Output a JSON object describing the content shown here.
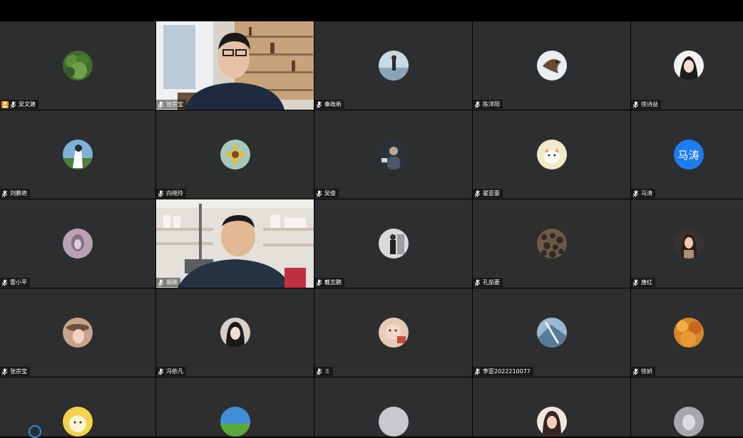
{
  "meeting": {
    "participants": [
      {
        "name": "吴文建",
        "host": true,
        "avatar": "leaf-plant-avatar"
      },
      {
        "name": "张宗宝",
        "video": true,
        "avatar": "video-man-glasses-bookshelf"
      },
      {
        "name": "秦政新",
        "avatar": "girl-seaside-avatar"
      },
      {
        "name": "陈洋阳",
        "avatar": "bird-avatar"
      },
      {
        "name": "徐诗益",
        "avatar": "woman-portrait-avatar"
      },
      {
        "name": "刘鹏艳",
        "avatar": "anime-girl-avatar"
      },
      {
        "name": "向晓玲",
        "avatar": "sunflower-avatar"
      },
      {
        "name": "吴俊",
        "avatar": "person-dark-avatar"
      },
      {
        "name": "翟亚豪",
        "avatar": "cat-cartoon-avatar"
      },
      {
        "name": "马涛",
        "avatar": "text-avatar",
        "avatar_text": "马涛"
      },
      {
        "name": "雷小平",
        "avatar": "pink-portrait-avatar"
      },
      {
        "name": "胡刚",
        "video": true,
        "avatar": "video-man-office"
      },
      {
        "name": "戴志鹏",
        "avatar": "man-standing-avatar"
      },
      {
        "name": "孔茄菱",
        "avatar": "stones-avatar"
      },
      {
        "name": "唐红",
        "avatar": "girl-brown-hair-avatar"
      },
      {
        "name": "张宗宝",
        "avatar": "girl-hat-avatar"
      },
      {
        "name": "冯依凡",
        "avatar": "dark-hair-girl-avatar"
      },
      {
        "name": "ミ",
        "avatar": "baby-avatar"
      },
      {
        "name": "李亚2022210077",
        "avatar": "blue-sky-avatar"
      },
      {
        "name": "徐娇",
        "avatar": "autumn-leaves-avatar"
      },
      {
        "name": "",
        "avatar": "cartoon-face-avatar"
      },
      {
        "name": "",
        "avatar": "green-field-avatar"
      },
      {
        "name": "",
        "avatar": "grey-default-avatar"
      },
      {
        "name": "",
        "avatar": "woman-face-avatar"
      },
      {
        "name": "",
        "avatar": "grey-portrait-avatar"
      }
    ]
  },
  "colors": {
    "tile_bg": "#2d2e30",
    "host_badge": "#ff8a00",
    "text_avatar_bg": "#1e7cf2",
    "accent_ring": "#2a8cff"
  }
}
